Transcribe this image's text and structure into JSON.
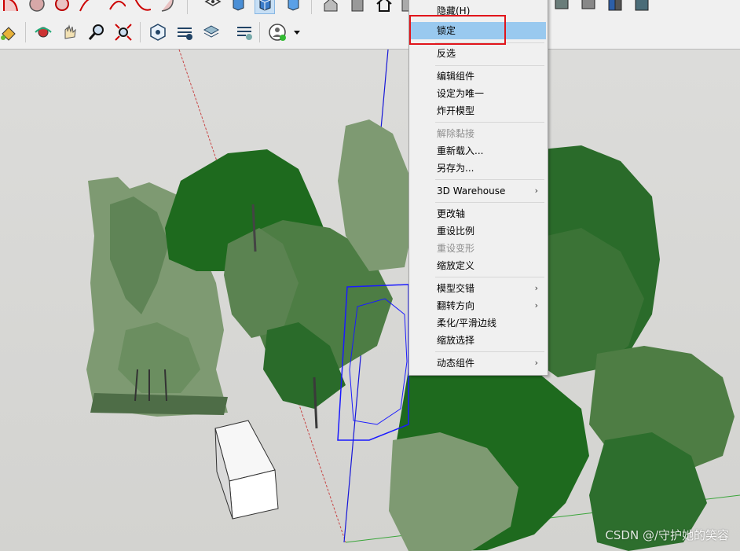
{
  "toolbar": {
    "row1_icons": [
      "arc-tool-icon",
      "rotated-rect-icon",
      "circle-tool-icon",
      "polygon-tool-icon",
      "pie-tool-icon",
      "two-point-arc-icon",
      "three-point-arc-icon",
      "standard-view-top-icon",
      "view-front-icon",
      "view-iso-icon",
      "view-right-icon",
      "house-view-icon",
      "house-back-icon",
      "home-icon",
      "view-left-icon",
      "component-view-1-icon",
      "component-view-2-icon",
      "component-view-3-icon",
      "component-view-4-icon"
    ],
    "row2_icons": [
      "paint-bucket-icon",
      "orbit-icon",
      "pan-hand-icon",
      "zoom-icon",
      "zoom-extents-icon",
      "component-options-icon",
      "component-attributes-icon",
      "layers-icon",
      "generate-report-icon",
      "user-account-icon",
      "dropdown-arrow-icon"
    ]
  },
  "context_menu": {
    "items": [
      {
        "label": "隐藏(H)",
        "disabled": false,
        "highlighted": false,
        "submenu": false
      },
      {
        "label": "锁定",
        "disabled": false,
        "highlighted": true,
        "submenu": false
      },
      {
        "label": "反选",
        "disabled": false,
        "highlighted": false,
        "submenu": false
      },
      {
        "label": "编辑组件",
        "disabled": false,
        "highlighted": false,
        "submenu": false
      },
      {
        "label": "设定为唯一",
        "disabled": false,
        "highlighted": false,
        "submenu": false
      },
      {
        "label": "炸开模型",
        "disabled": false,
        "highlighted": false,
        "submenu": false
      },
      {
        "label": "解除黏接",
        "disabled": true,
        "highlighted": false,
        "submenu": false
      },
      {
        "label": "重新载入...",
        "disabled": false,
        "highlighted": false,
        "submenu": false
      },
      {
        "label": "另存为...",
        "disabled": false,
        "highlighted": false,
        "submenu": false
      },
      {
        "label": "3D Warehouse",
        "disabled": false,
        "highlighted": false,
        "submenu": true
      },
      {
        "label": "更改轴",
        "disabled": false,
        "highlighted": false,
        "submenu": false
      },
      {
        "label": "重设比例",
        "disabled": false,
        "highlighted": false,
        "submenu": false
      },
      {
        "label": "重设变形",
        "disabled": true,
        "highlighted": false,
        "submenu": false
      },
      {
        "label": "缩放定义",
        "disabled": false,
        "highlighted": false,
        "submenu": false
      },
      {
        "label": "模型交错",
        "disabled": false,
        "highlighted": false,
        "submenu": true
      },
      {
        "label": "翻转方向",
        "disabled": false,
        "highlighted": false,
        "submenu": true
      },
      {
        "label": "柔化/平滑边线",
        "disabled": false,
        "highlighted": false,
        "submenu": false
      },
      {
        "label": "缩放选择",
        "disabled": false,
        "highlighted": false,
        "submenu": false
      },
      {
        "label": "动态组件",
        "disabled": false,
        "highlighted": false,
        "submenu": true
      }
    ],
    "submenu_arrow": "›"
  },
  "viewport": {
    "scene_objects": [
      "tree-group-left",
      "tree-group-center",
      "tree-group-right",
      "selected-tree-component",
      "white-box",
      "blue-axis",
      "red-axis",
      "green-axis"
    ]
  },
  "watermark": "CSDN @/守护她的笑容",
  "colors": {
    "menu_highlight": "#99c9ef",
    "annotation_red": "#e1151b",
    "selection_blue": "#1a1aff",
    "tree_dark": "#1e6a1e",
    "tree_mid": "#4e7d44",
    "tree_light": "#7e9a72"
  }
}
